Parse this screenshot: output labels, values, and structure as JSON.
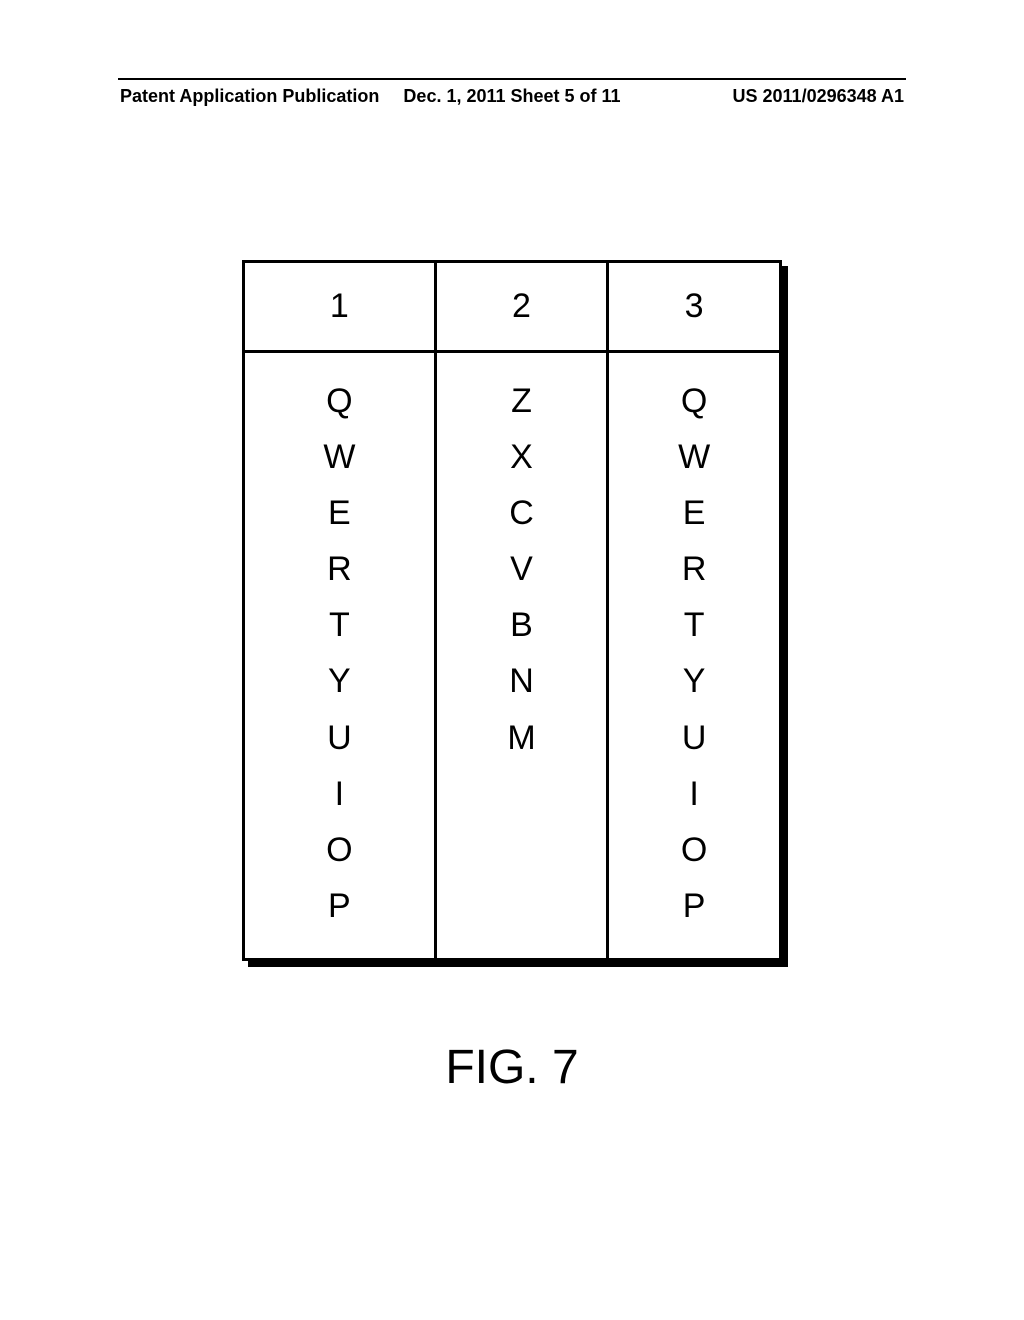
{
  "header": {
    "pub_type": "Patent Application Publication",
    "date_sheet": "Dec. 1, 2011   Sheet 5 of 11",
    "pub_number": "US 2011/0296348 A1"
  },
  "table": {
    "headers": [
      "1",
      "2",
      "3"
    ],
    "columns": [
      [
        "Q",
        "W",
        "E",
        "R",
        "T",
        "Y",
        "U",
        "I",
        "O",
        "P"
      ],
      [
        "Z",
        "X",
        "C",
        "V",
        "B",
        "N",
        "M"
      ],
      [
        "Q",
        "W",
        "E",
        "R",
        "T",
        "Y",
        "U",
        "I",
        "O",
        "P"
      ]
    ]
  },
  "caption": "FIG. 7"
}
